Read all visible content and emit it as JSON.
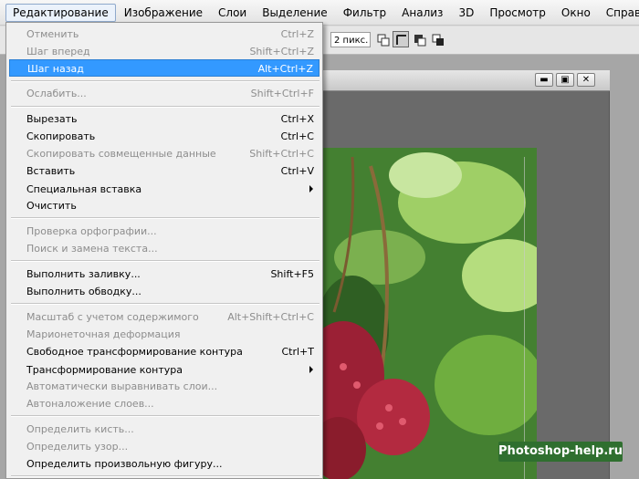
{
  "menubar": {
    "items": [
      "Редактирование",
      "Изображение",
      "Слои",
      "Выделение",
      "Фильтр",
      "Анализ",
      "3D",
      "Просмотр",
      "Окно",
      "Справка"
    ],
    "active_index": 0
  },
  "options_bar": {
    "size_value": "2 пикс."
  },
  "watermark": "Photoshop-help.ru",
  "edit_menu": {
    "items": [
      {
        "label": "Отменить",
        "shortcut": "Ctrl+Z",
        "disabled": true
      },
      {
        "label": "Шаг вперед",
        "shortcut": "Shift+Ctrl+Z",
        "disabled": true
      },
      {
        "label": "Шаг назад",
        "shortcut": "Alt+Ctrl+Z",
        "disabled": false,
        "highlighted": true
      },
      {
        "label": "Ослабить...",
        "shortcut": "Shift+Ctrl+F",
        "disabled": true
      },
      {
        "label": "Вырезать",
        "shortcut": "Ctrl+X",
        "disabled": false
      },
      {
        "label": "Скопировать",
        "shortcut": "Ctrl+C",
        "disabled": false
      },
      {
        "label": "Скопировать совмещенные данные",
        "shortcut": "Shift+Ctrl+C",
        "disabled": true
      },
      {
        "label": "Вставить",
        "shortcut": "Ctrl+V",
        "disabled": false
      },
      {
        "label": "Специальная вставка",
        "shortcut": "",
        "disabled": false,
        "submenu": true
      },
      {
        "label": "Очистить",
        "shortcut": "",
        "disabled": false
      },
      {
        "label": "Проверка орфографии...",
        "shortcut": "",
        "disabled": true
      },
      {
        "label": "Поиск и замена текста...",
        "shortcut": "",
        "disabled": true
      },
      {
        "label": "Выполнить заливку...",
        "shortcut": "Shift+F5",
        "disabled": false
      },
      {
        "label": "Выполнить обводку...",
        "shortcut": "",
        "disabled": false
      },
      {
        "label": "Масштаб с учетом содержимого",
        "shortcut": "Alt+Shift+Ctrl+C",
        "disabled": true
      },
      {
        "label": "Марионеточная деформация",
        "shortcut": "",
        "disabled": true
      },
      {
        "label": "Свободное трансформирование контура",
        "shortcut": "Ctrl+T",
        "disabled": false
      },
      {
        "label": "Трансформирование контура",
        "shortcut": "",
        "disabled": false,
        "submenu": true
      },
      {
        "label": "Автоматически выравнивать слои...",
        "shortcut": "",
        "disabled": true
      },
      {
        "label": "Автоналожение слоев...",
        "shortcut": "",
        "disabled": true
      },
      {
        "label": "Определить кисть...",
        "shortcut": "",
        "disabled": true
      },
      {
        "label": "Определить узор...",
        "shortcut": "",
        "disabled": true
      },
      {
        "label": "Определить произвольную фигуру...",
        "shortcut": "",
        "disabled": false
      }
    ]
  },
  "colors": {
    "highlight": "#3399ff",
    "disabled_text": "#8d8d8d",
    "watermark_bg": "#2f6f2f"
  }
}
